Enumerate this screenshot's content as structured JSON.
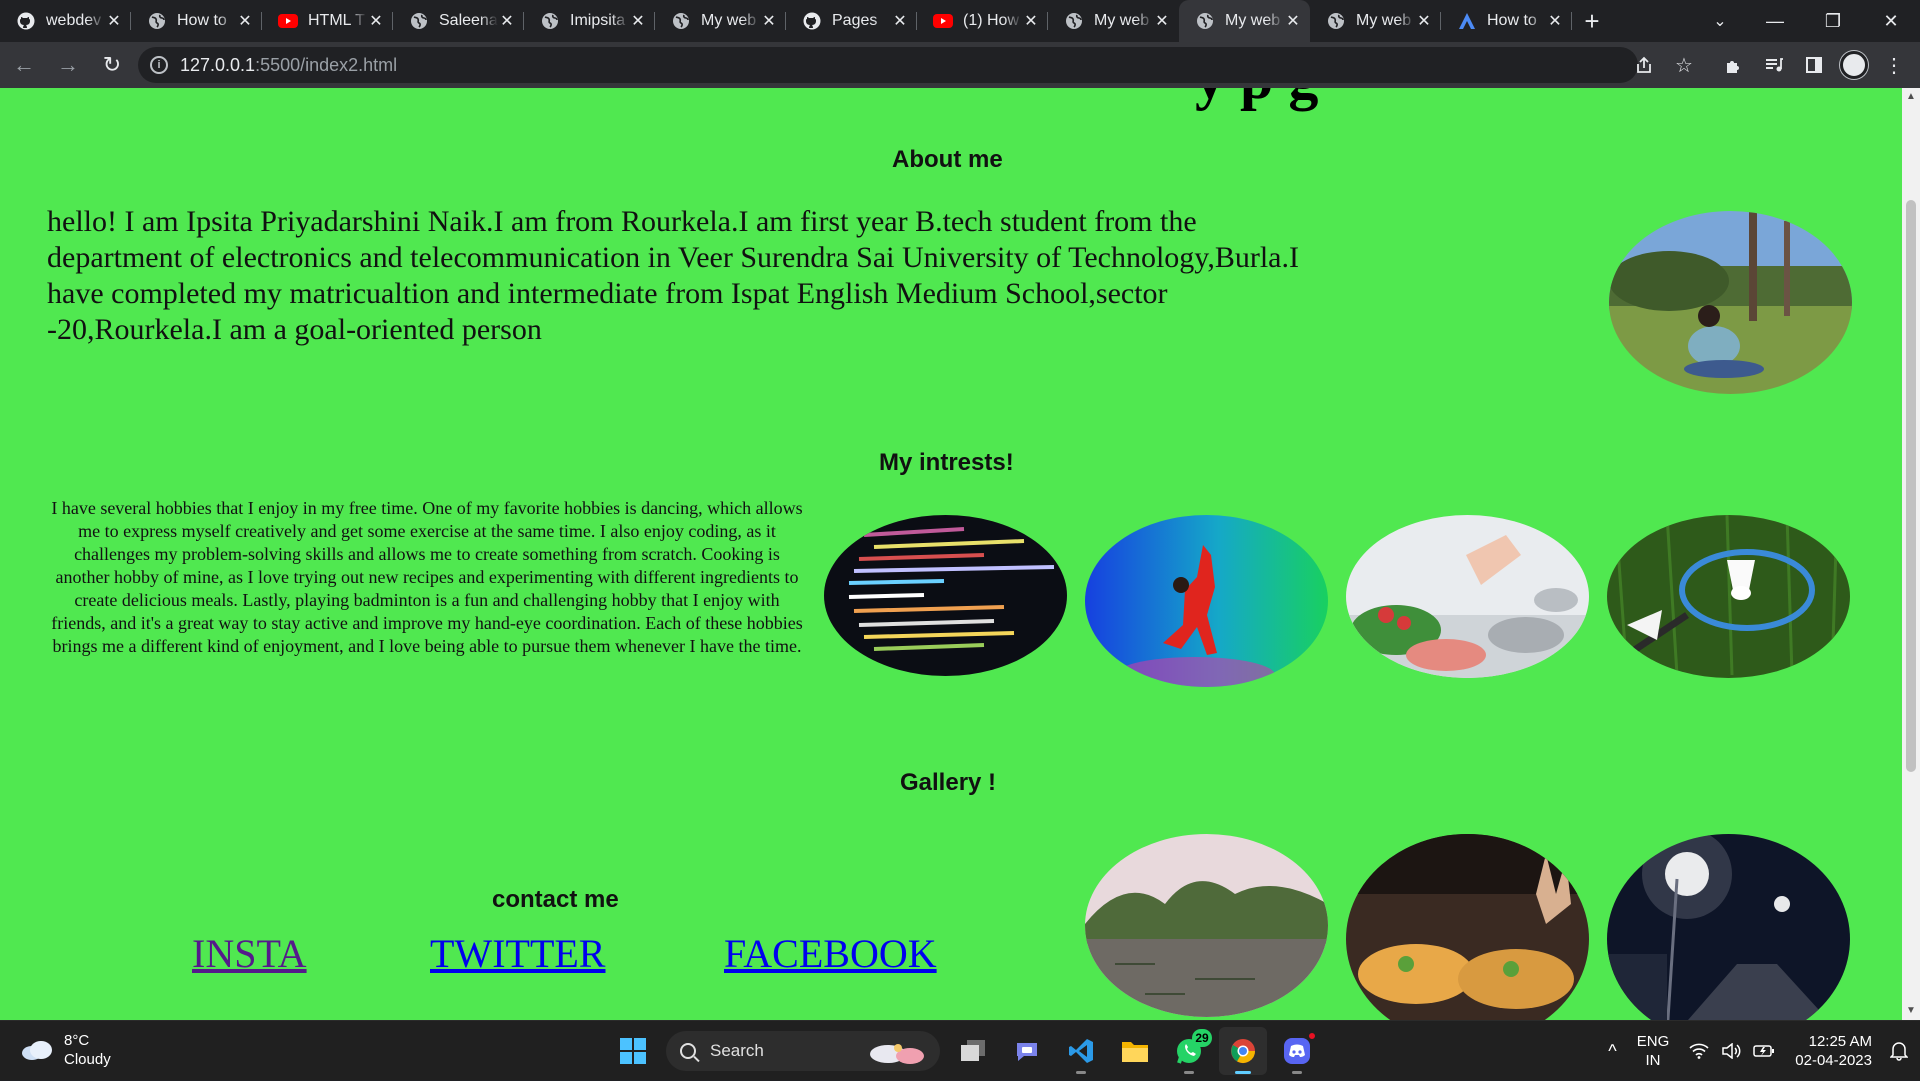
{
  "browser": {
    "tabs": [
      {
        "title": "webdev",
        "icon": "github-icon"
      },
      {
        "title": "How to",
        "icon": "globe-icon"
      },
      {
        "title": "HTML T",
        "icon": "youtube-icon"
      },
      {
        "title": "Saleena",
        "icon": "globe-icon"
      },
      {
        "title": "Imipsita",
        "icon": "globe-icon"
      },
      {
        "title": "My web",
        "icon": "globe-icon"
      },
      {
        "title": "Pages",
        "icon": "github-icon"
      },
      {
        "title": "(1) How",
        "icon": "youtube-icon"
      },
      {
        "title": "My web",
        "icon": "globe-icon"
      },
      {
        "title": "My web",
        "icon": "globe-icon",
        "active": true
      },
      {
        "title": "My web",
        "icon": "globe-icon"
      },
      {
        "title": "How to",
        "icon": "a-logo-icon"
      }
    ],
    "url_host": "127.0.0.1",
    "url_path": ":5500/index2.html"
  },
  "page": {
    "about_heading": "About me",
    "about_text": "hello! I am Ipsita Priyadarshini Naik.I am from Rourkela.I am first year B.tech student from the department of electronics and telecommunication in Veer Surendra Sai University of Technology,Burla.I have completed my matricualtion and intermediate from Ispat English Medium School,sector -20,Rourkela.I am a goal-oriented person",
    "interests_heading": "My intrests!",
    "interests_text": "I have several hobbies that I enjoy in my free time. One of my favorite hobbies is dancing, which allows me to express myself creatively and get some exercise at the same time. I also enjoy coding, as it challenges my problem-solving skills and allows me to create something from scratch. Cooking is another hobby of mine, as I love trying out new recipes and experimenting with different ingredients to create delicious meals. Lastly, playing badminton is a fun and challenging hobby that I enjoy with friends, and it's a great way to stay active and improve my hand-eye coordination. Each of these hobbies brings me a different kind of enjoyment, and I love being able to pursue them whenever I have the time.",
    "gallery_heading": "Gallery !",
    "contact_heading": "contact me",
    "links": [
      "INSTA",
      "TWITTER",
      "FACEBOOK"
    ]
  },
  "taskbar": {
    "temperature": "8°C",
    "weather": "Cloudy",
    "search_label": "Search",
    "whatsapp_badge": "29",
    "lang_top": "ENG",
    "lang_bottom": "IN",
    "time": "12:25 AM",
    "date": "02-04-2023"
  },
  "colors": {
    "page_background": "#50e850",
    "tab_active": "#35363a",
    "taskbar": "#202020"
  }
}
